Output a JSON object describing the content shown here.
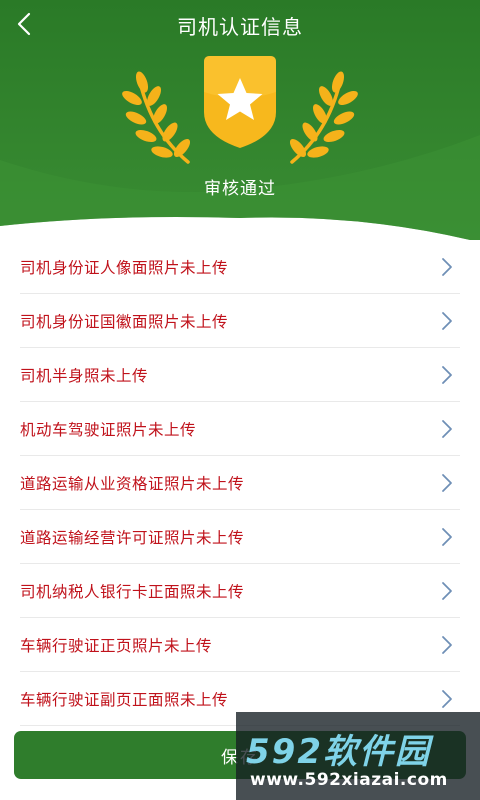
{
  "header": {
    "title": "司机认证信息",
    "status": "审核通过"
  },
  "items": [
    {
      "label": "司机身份证人像面照片未上传"
    },
    {
      "label": "司机身份证国徽面照片未上传"
    },
    {
      "label": "司机半身照未上传"
    },
    {
      "label": "机动车驾驶证照片未上传"
    },
    {
      "label": "道路运输从业资格证照片未上传"
    },
    {
      "label": "道路运输经营许可证照片未上传"
    },
    {
      "label": "司机纳税人银行卡正面照未上传"
    },
    {
      "label": "车辆行驶证正页照片未上传"
    },
    {
      "label": "车辆行驶证副页正面照未上传"
    }
  ],
  "save": {
    "label": "保存"
  },
  "watermark": {
    "brand": "592软件园",
    "url": "www.592xiazai.com"
  },
  "colors": {
    "header_green": "#2f7d2c",
    "item_red": "#c0121b",
    "badge_gold": "#f5b21a"
  }
}
